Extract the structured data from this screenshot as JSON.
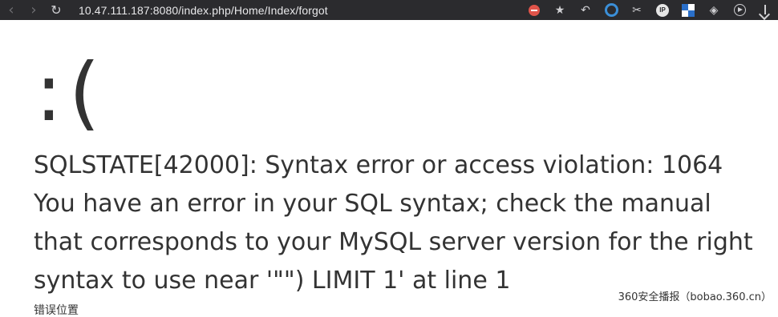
{
  "browser": {
    "url": "10.47.111.187:8080/index.php/Home/Index/forgot",
    "nav": {
      "back_glyph": "‹",
      "forward_glyph": "›",
      "reload_glyph": "↻"
    },
    "toolbar_icons": [
      "stop-icon",
      "star-icon",
      "undo-icon",
      "ring-extension-icon",
      "scissors-icon",
      "ip-icon",
      "tile-extension-icon",
      "globe-extension-icon",
      "play-icon",
      "download-icon"
    ],
    "star_glyph": "★",
    "undo_glyph": "↶",
    "scissors_glyph": "✂",
    "ip_label": "IP",
    "globe_glyph": "◈"
  },
  "page": {
    "face": ":(",
    "error_message": "SQLSTATE[42000]: Syntax error or access violation: 1064 You have an error in your SQL syntax; check the manual that corresponds to your MySQL server version for the right syntax to use near '\"\") LIMIT 1' at line 1",
    "error_location_label": "错误位置"
  },
  "watermark": {
    "text": "360安全播报（bobao.360.cn）"
  },
  "colors": {
    "toolbar_bg": "#2b2b2e",
    "text": "#333333",
    "stop_red": "#e0544a",
    "extension_blue": "#3b8fd8"
  }
}
